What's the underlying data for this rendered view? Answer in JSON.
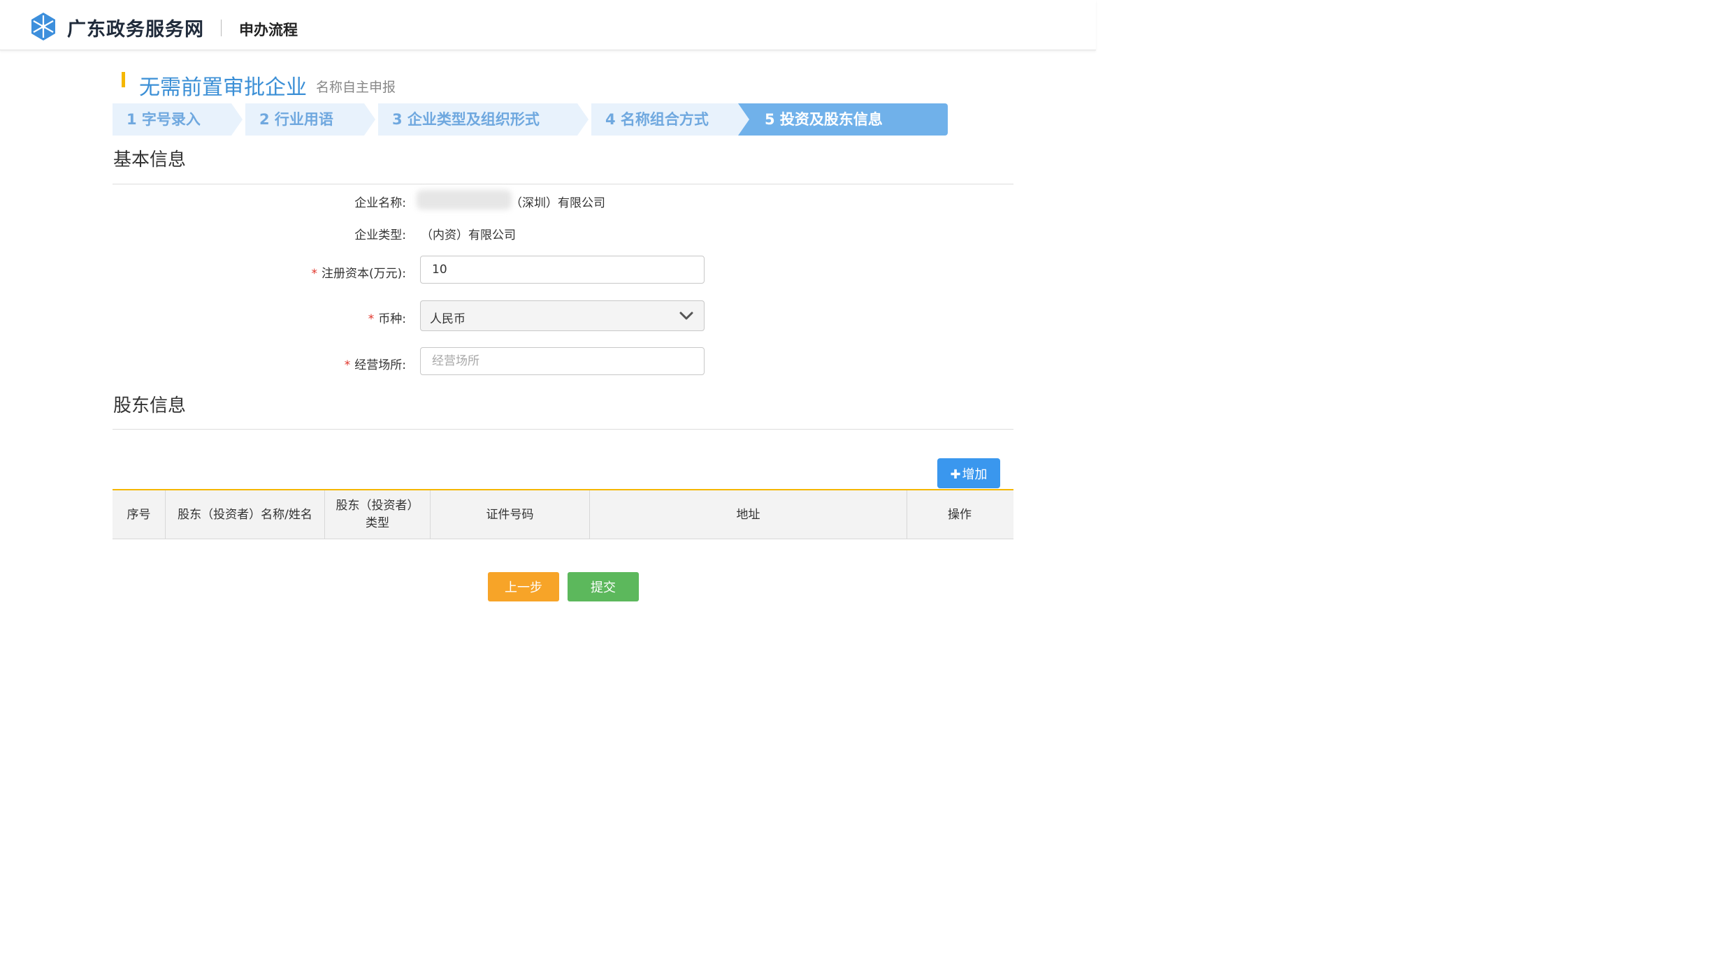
{
  "header": {
    "site_name": "广东政务服务网",
    "sub_title": "申办流程"
  },
  "page": {
    "title": "无需前置审批企业",
    "subtitle": "名称自主申报"
  },
  "steps": [
    {
      "label": "1 字号录入",
      "active": false
    },
    {
      "label": "2 行业用语",
      "active": false
    },
    {
      "label": "3 企业类型及组织形式",
      "active": false
    },
    {
      "label": "4 名称组合方式",
      "active": false
    },
    {
      "label": "5 投资及股东信息",
      "active": true
    }
  ],
  "basic_info": {
    "section_title": "基本信息",
    "company_name_label": "企业名称:",
    "company_name_suffix": "（深圳）有限公司",
    "company_type_label": "企业类型:",
    "company_type_value": "（内资）有限公司",
    "registered_capital_label": "注册资本(万元):",
    "registered_capital_value": "10",
    "currency_label": "币种:",
    "currency_value": "人民币",
    "business_place_label": "经营场所:",
    "business_place_placeholder": "经营场所",
    "required_mark": "*"
  },
  "shareholder_info": {
    "section_title": "股东信息",
    "add_button_label": "增加",
    "add_button_icon": "plus-icon",
    "columns": [
      "序号",
      "股东（投资者）名称/姓名",
      "股东（投资者）类型",
      "证件号码",
      "地址",
      "操作"
    ]
  },
  "footer": {
    "prev_label": "上一步",
    "submit_label": "提交"
  },
  "colors": {
    "accent_blue": "#3a97ee",
    "title_blue": "#3b8fd6",
    "step_bg": "#e8f2fc",
    "step_active": "#70b1ea",
    "accent_yellow": "#f5b700",
    "prev_orange": "#f7a428",
    "submit_green": "#5cb85c",
    "required_red": "#e0342a"
  }
}
